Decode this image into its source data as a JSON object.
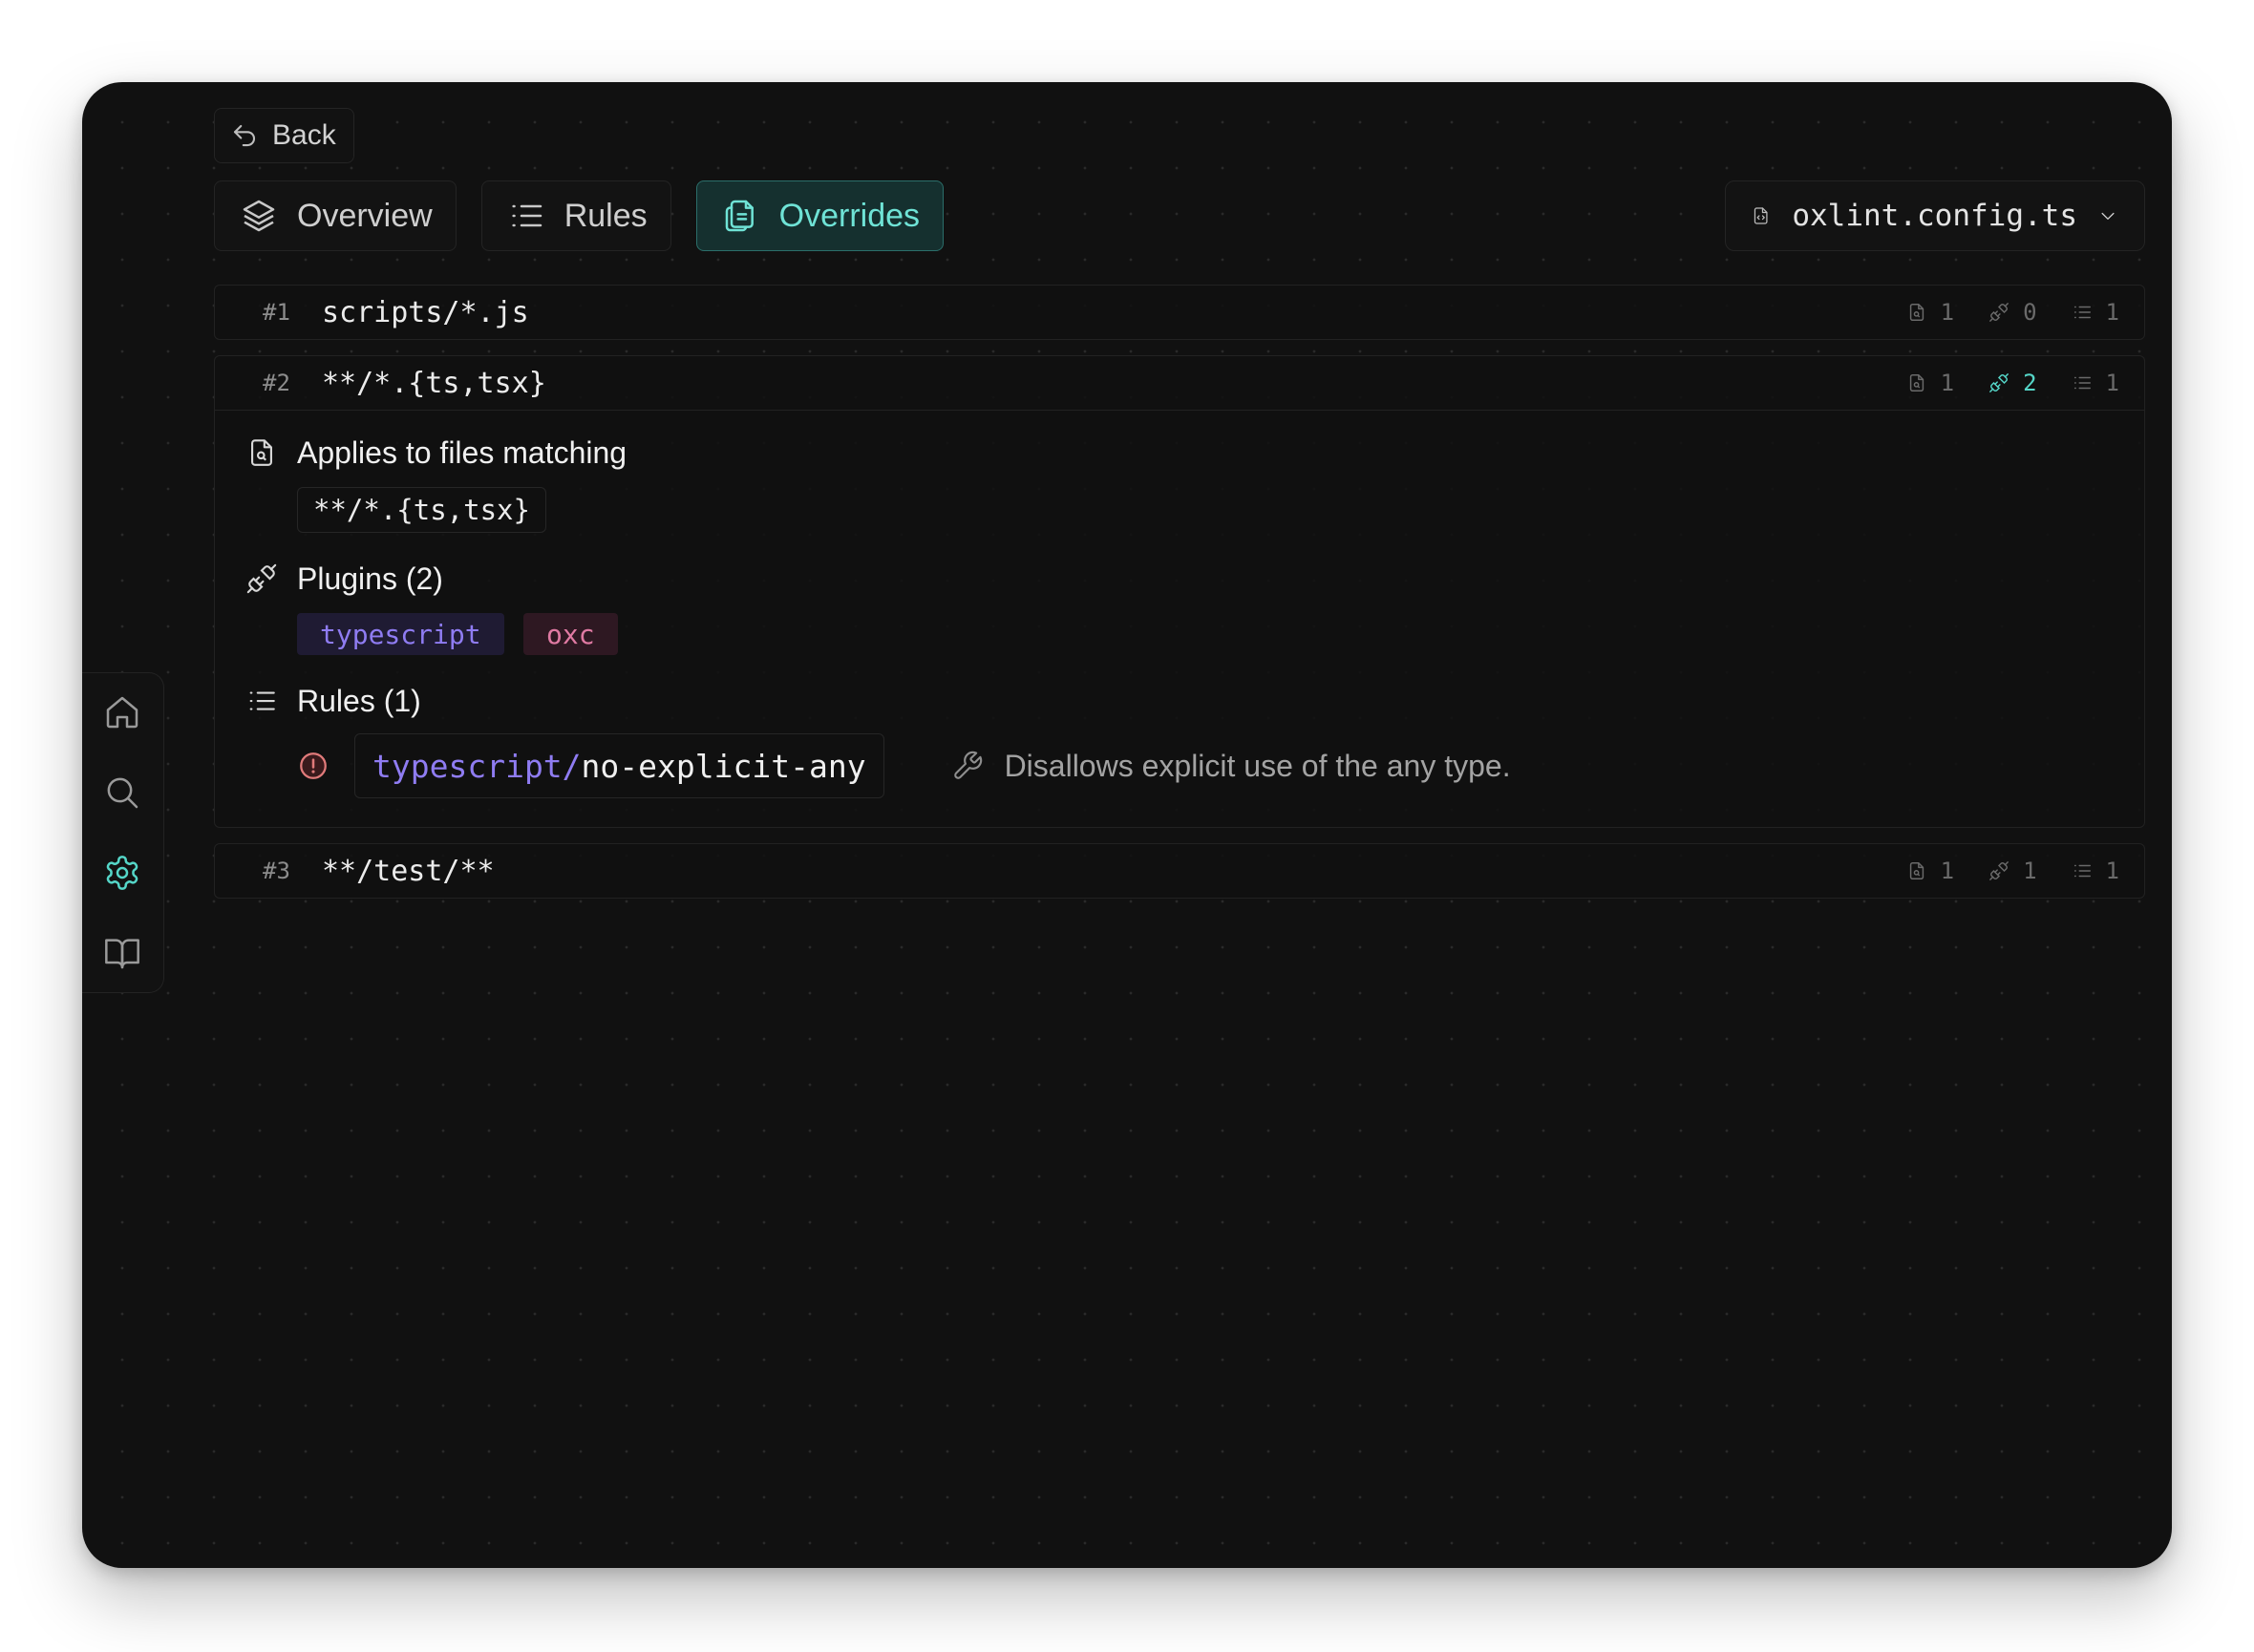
{
  "header": {
    "back_label": "Back"
  },
  "tabs": [
    {
      "label": "Overview",
      "icon": "layers-icon",
      "active": false
    },
    {
      "label": "Rules",
      "icon": "list-icon",
      "active": false
    },
    {
      "label": "Overrides",
      "icon": "files-icon",
      "active": true
    }
  ],
  "file_select": {
    "value": "oxlint.config.ts"
  },
  "overrides": [
    {
      "num": "#1",
      "pattern": "scripts/*.js",
      "files": "1",
      "plugins": "0",
      "rules": "1"
    },
    {
      "num": "#2",
      "pattern": "**/*.{ts,tsx}",
      "files": "1",
      "plugins": "2",
      "rules": "1",
      "details": {
        "applies_title": "Applies to files matching",
        "applies_pattern": "**/*.{ts,tsx}",
        "plugins_title": "Plugins (2)",
        "plugins": [
          "typescript",
          "oxc"
        ],
        "rules_title": "Rules (1)",
        "rule_plugin": "typescript/",
        "rule_name": "no-explicit-any",
        "rule_description": "Disallows explicit use of the any type."
      }
    },
    {
      "num": "#3",
      "pattern": "**/test/**",
      "files": "1",
      "plugins": "1",
      "rules": "1"
    }
  ],
  "dock": [
    "home-icon",
    "search-icon",
    "settings-icon",
    "book-icon"
  ],
  "colors": {
    "accent": "#55d6c8",
    "plugin_typescript": "#8f7cf2",
    "plugin_oxc": "#e07aa3",
    "severity_error": "#e07a7a"
  }
}
